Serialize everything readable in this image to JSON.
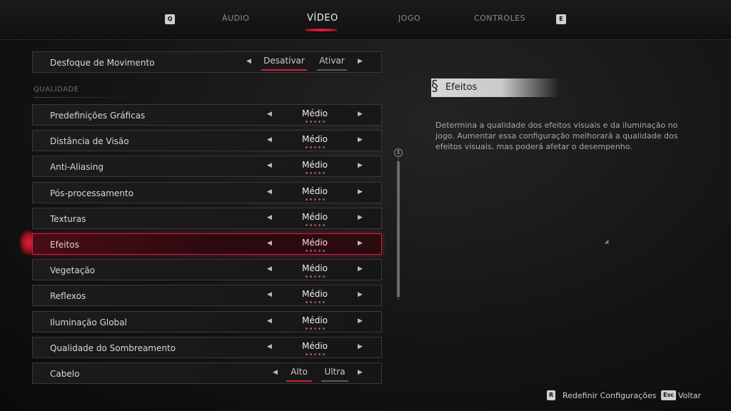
{
  "nav": {
    "prev_key": "Q",
    "next_key": "E",
    "tabs": [
      {
        "label": "ÁUDIO",
        "active": false
      },
      {
        "label": "VÍDEO",
        "active": true
      },
      {
        "label": "JOGO",
        "active": false
      },
      {
        "label": "CONTROLES",
        "active": false
      }
    ]
  },
  "motion_blur": {
    "label": "Desfoque de Movimento",
    "options": [
      "Desativar",
      "Ativar"
    ],
    "selected": "Desativar"
  },
  "section_title": "QUALIDADE",
  "settings": [
    {
      "label": "Predefinições Gráficas",
      "value": "Médio",
      "level": 3,
      "levels": 5
    },
    {
      "label": "Distância de Visão",
      "value": "Médio",
      "level": 3,
      "levels": 5
    },
    {
      "label": "Anti-Aliasing",
      "value": "Médio",
      "level": 3,
      "levels": 5
    },
    {
      "label": "Pós-processamento",
      "value": "Médio",
      "level": 3,
      "levels": 5
    },
    {
      "label": "Texturas",
      "value": "Médio",
      "level": 3,
      "levels": 5
    },
    {
      "label": "Efeitos",
      "value": "Médio",
      "level": 3,
      "levels": 5,
      "selected": true
    },
    {
      "label": "Vegetação",
      "value": "Médio",
      "level": 3,
      "levels": 5
    },
    {
      "label": "Reflexos",
      "value": "Médio",
      "level": 3,
      "levels": 5
    },
    {
      "label": "Iluminação Global",
      "value": "Médio",
      "level": 3,
      "levels": 5
    },
    {
      "label": "Qualidade do Sombreamento",
      "value": "Médio",
      "level": 3,
      "levels": 5
    }
  ],
  "hair": {
    "label": "Cabelo",
    "options": [
      "Alto",
      "Ultra"
    ],
    "selected": "Alto"
  },
  "description": {
    "title": "Efeitos",
    "text": "Determina a qualidade dos efeitos visuais e da iluminação no jogo. Aumentar essa configuração melhorará a qualidade dos efeitos visuais, mas poderá afetar o desempenho."
  },
  "footer": {
    "reset_key": "R",
    "reset_label": "Redefinir Configurações",
    "back_key": "Esc",
    "back_label": "Voltar"
  },
  "colors": {
    "accent": "#d0203a",
    "background": "#141414"
  }
}
